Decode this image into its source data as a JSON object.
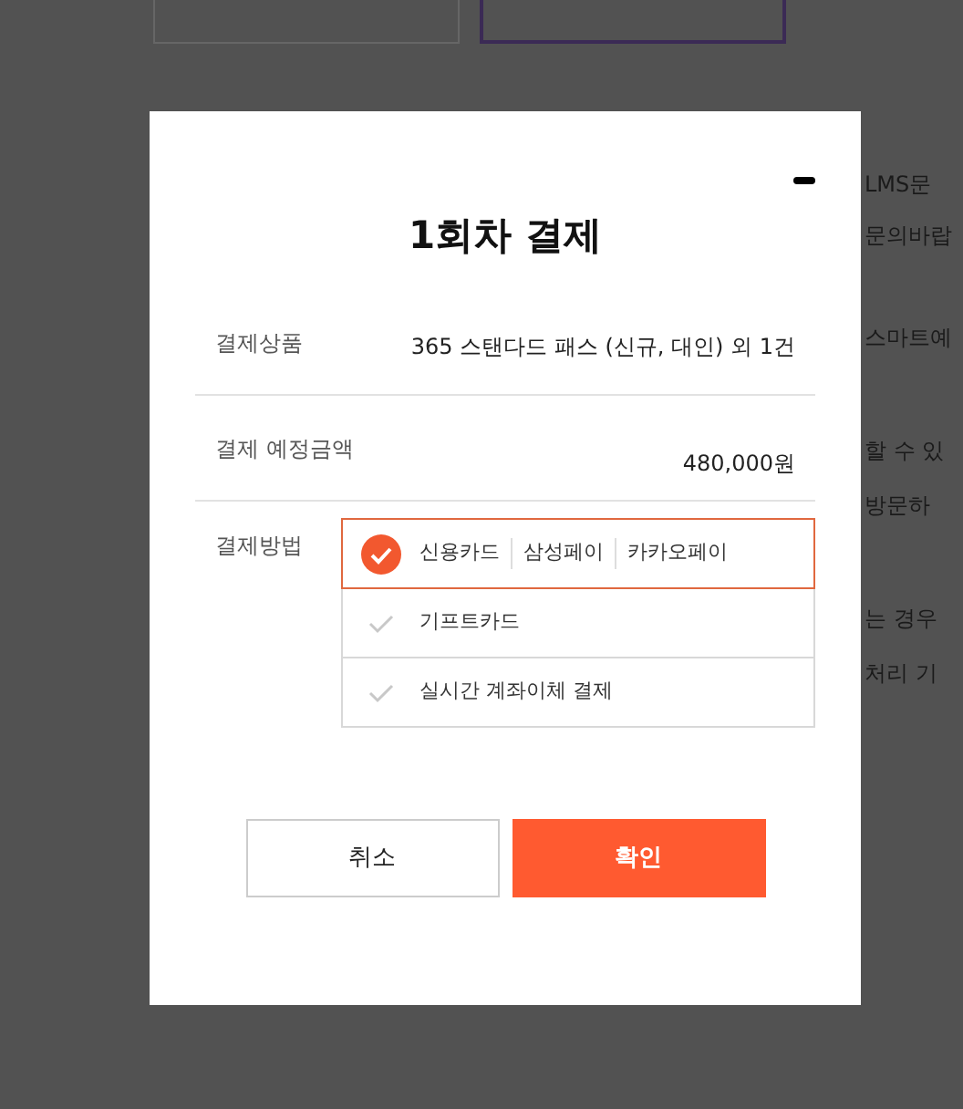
{
  "background_text": [
    "LMS문",
    "문의바랍",
    "스마트예",
    "할 수 있",
    "방문하",
    "는 경우",
    "처리 기"
  ],
  "modal": {
    "title": "1회차 결제",
    "rows": [
      {
        "label": "결제상품",
        "value": "365 스탠다드 패스 (신규, 대인) 외 1건"
      },
      {
        "label": "결제 예정금액",
        "value": "480,000원"
      }
    ],
    "payment": {
      "label": "결제방법",
      "options": [
        {
          "labels": [
            "신용카드",
            "삼성페이",
            "카카오페이"
          ],
          "selected": true
        },
        {
          "labels": [
            "기프트카드"
          ],
          "selected": false
        },
        {
          "labels": [
            "실시간 계좌이체 결제"
          ],
          "selected": false
        }
      ]
    },
    "buttons": [
      {
        "label": "취소",
        "kind": "secondary"
      },
      {
        "label": "확인",
        "kind": "primary"
      }
    ]
  }
}
